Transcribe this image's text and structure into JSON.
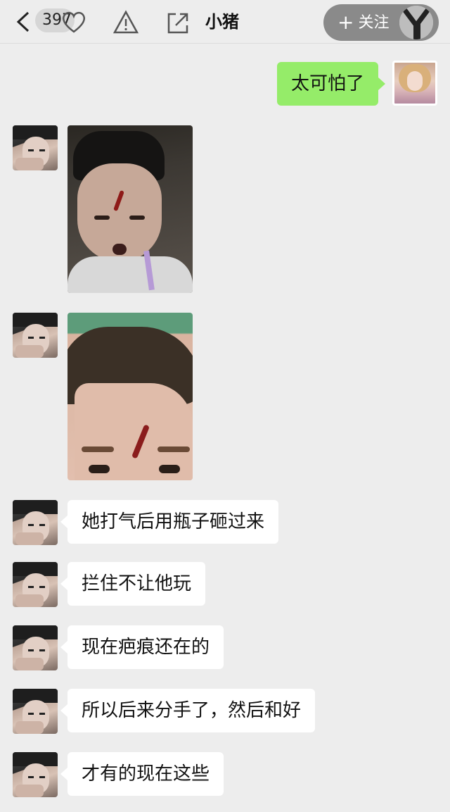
{
  "header": {
    "badge_count": "397",
    "title": "小猪",
    "follow_label": "关注",
    "follow_plus": "+"
  },
  "messages": [
    {
      "sender": "me",
      "type": "text",
      "text": "太可怕了"
    },
    {
      "sender": "other",
      "type": "image",
      "alt": ""
    },
    {
      "sender": "other",
      "type": "image",
      "alt": ""
    },
    {
      "sender": "other",
      "type": "text",
      "text": "她打气后用瓶子砸过来"
    },
    {
      "sender": "other",
      "type": "text",
      "text": "拦住不让他玩"
    },
    {
      "sender": "other",
      "type": "text",
      "text": "现在疤痕还在的"
    },
    {
      "sender": "other",
      "type": "text",
      "text": "所以后来分手了，然后和好"
    },
    {
      "sender": "other",
      "type": "text",
      "text": "才有的现在这些"
    }
  ],
  "colors": {
    "background": "#ededed",
    "my_bubble": "#95ec69",
    "their_bubble": "#ffffff",
    "follow_button": "#8a8a8a"
  },
  "icons": [
    "back-icon",
    "heart-icon",
    "warning-icon",
    "share-icon",
    "plus-icon"
  ]
}
